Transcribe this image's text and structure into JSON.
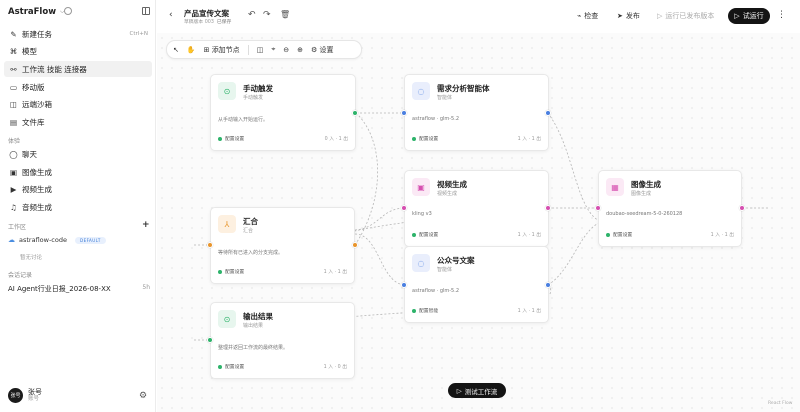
{
  "sidebar": {
    "brand": "AstraFlow",
    "nav": [
      {
        "icon": "✎",
        "label": "新建任务",
        "shortcut": "Ctrl+N",
        "name": "nav-new-task"
      },
      {
        "icon": "⌘",
        "label": "模型",
        "shortcut": "",
        "name": "nav-models"
      },
      {
        "icon": "⚯",
        "label": "工作流 技能 连接器",
        "shortcut": "",
        "name": "nav-workflow"
      },
      {
        "icon": "▭",
        "label": "移动版",
        "shortcut": "",
        "name": "nav-mobile"
      },
      {
        "icon": "◫",
        "label": "远端沙箱",
        "shortcut": "",
        "name": "nav-sandbox"
      },
      {
        "icon": "▤",
        "label": "文件库",
        "shortcut": "",
        "name": "nav-files"
      }
    ],
    "experience_label": "体验",
    "experience": [
      {
        "icon": "◯",
        "label": "聊天",
        "name": "nav-chat"
      },
      {
        "icon": "▣",
        "label": "图像生成",
        "name": "nav-image-gen"
      },
      {
        "icon": "▶",
        "label": "视频生成",
        "name": "nav-video-gen"
      },
      {
        "icon": "♫",
        "label": "音频生成",
        "name": "nav-audio-gen"
      }
    ],
    "workspace_label": "工作区",
    "workspace": {
      "name": "astraflow-code",
      "badge": "DEFAULT",
      "sub": "暂无讨论"
    },
    "sessions_label": "会话记录",
    "sessions": [
      {
        "title": "AI Agent行业日报_2026-08-XX",
        "time": "5h"
      }
    ],
    "user": {
      "avatar": "张号",
      "name": "张号",
      "role": "账号"
    }
  },
  "topbar": {
    "title": "产品宣传文案",
    "subtitle": "草稿版本 003",
    "saved": "已保存",
    "check": "检查",
    "publish": "发布",
    "run_published": "运行已发布版本",
    "run": "试运行"
  },
  "toolbar": {
    "add_node": "添加节点",
    "settings": "设置"
  },
  "nodes": {
    "manual": {
      "title": "手动触发",
      "sub": "手动触发",
      "desc": "从手动输入开始运行。",
      "footer": "配置设置",
      "io": "0 入 · 1 出"
    },
    "merge": {
      "title": "汇合",
      "sub": "汇合",
      "desc": "等待所有已进入的分支完成。",
      "footer": "配置设置",
      "io": "1 入 · 1 出"
    },
    "output": {
      "title": "输出结果",
      "sub": "输出结果",
      "desc": "整理并返回工作流的最终结果。",
      "footer": "配置设置",
      "io": "1 入 · 0 出"
    },
    "analysis": {
      "title": "需求分析智能体",
      "sub": "智能体",
      "desc": "astraflow · glm-5.2",
      "footer": "配置设置",
      "io": "1 入 · 1 出"
    },
    "video": {
      "title": "视频生成",
      "sub": "视频生成",
      "desc": "kling v3",
      "footer": "配置设置",
      "io": "1 入 · 1 出"
    },
    "wechat": {
      "title": "公众号文案",
      "sub": "智能体",
      "desc": "astraflow · glm-5.2",
      "footer": "配置智能",
      "io": "1 入 · 1 出"
    },
    "image": {
      "title": "图像生成",
      "sub": "图像生成",
      "desc": "doubao-seedream-5-0-260128",
      "footer": "配置设置",
      "io": "1 入 · 1 出"
    }
  },
  "test_button": "测试工作流",
  "credit": "React Flow",
  "colors": {
    "accent_dark": "#141414",
    "port_green": "#2db36a",
    "port_blue": "#4a7fe0",
    "port_pink": "#d64fb0",
    "port_orange": "#e8952c"
  }
}
